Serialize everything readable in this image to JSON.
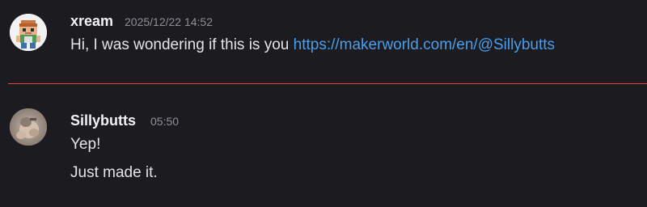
{
  "messages": [
    {
      "author": "xream",
      "timestamp": "2025/12/22 14:52",
      "text_prefix": "Hi, I was wondering if this is you ",
      "link": "https://makerworld.com/en/@Sillybutts"
    },
    {
      "author": "Sillybutts",
      "timestamp": "05:50",
      "lines": [
        "Yep!",
        "Just made it."
      ]
    }
  ],
  "colors": {
    "background": "#1b1b20",
    "link": "#4a9eed",
    "new_messages_divider": "#e0434a",
    "timestamp": "#8e9099"
  },
  "icons": {
    "avatar_1": "pixel-character-avatar",
    "avatar_2": "photo-avatar"
  }
}
